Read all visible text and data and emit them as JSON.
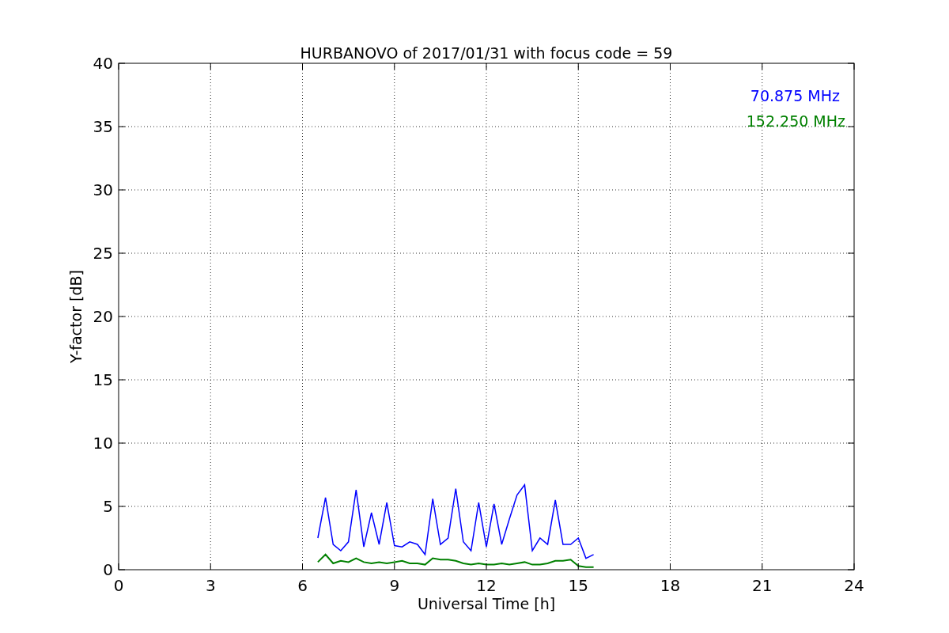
{
  "figure": {
    "chart_data": {
      "type": "line",
      "title": "HURBANOVO of 2017/01/31 with focus code = 59",
      "xlabel": "Universal Time [h]",
      "ylabel": "Y-factor [dB]",
      "x": [
        6.5,
        6.75,
        7,
        7.25,
        7.5,
        7.75,
        8,
        8.25,
        8.5,
        8.75,
        9,
        9.25,
        9.5,
        9.75,
        10,
        10.25,
        10.5,
        10.75,
        11,
        11.25,
        11.5,
        11.75,
        12,
        12.25,
        12.5,
        12.75,
        13,
        13.25,
        13.5,
        13.75,
        14,
        14.25,
        14.5,
        14.75,
        15,
        15.25,
        15.5
      ],
      "series": [
        {
          "name": "70.875 MHz",
          "color": "#0000ff",
          "values": [
            2.5,
            5.7,
            2.0,
            1.5,
            2.2,
            6.3,
            1.8,
            4.5,
            2.0,
            5.3,
            1.9,
            1.8,
            2.2,
            2.0,
            1.2,
            5.6,
            2.0,
            2.5,
            6.4,
            2.2,
            1.5,
            5.3,
            1.8,
            5.2,
            2.0,
            4.0,
            5.9,
            6.7,
            1.5,
            2.5,
            2.0,
            5.5,
            2.0,
            2.0,
            2.5,
            0.9,
            1.2
          ]
        },
        {
          "name": "152.250 MHz",
          "color": "#008000",
          "values": [
            0.6,
            1.2,
            0.5,
            0.7,
            0.6,
            0.9,
            0.6,
            0.5,
            0.6,
            0.5,
            0.6,
            0.7,
            0.5,
            0.5,
            0.4,
            0.9,
            0.8,
            0.8,
            0.7,
            0.5,
            0.4,
            0.5,
            0.4,
            0.4,
            0.5,
            0.4,
            0.5,
            0.6,
            0.4,
            0.4,
            0.5,
            0.7,
            0.7,
            0.8,
            0.3,
            0.2,
            0.2
          ]
        }
      ],
      "grid": true,
      "xlim": [
        0,
        24
      ],
      "ylim": [
        0,
        40
      ],
      "xticks": [
        0,
        3,
        6,
        9,
        12,
        15,
        18,
        21,
        24
      ],
      "yticks": [
        0,
        5,
        10,
        15,
        20,
        25,
        30,
        35,
        40
      ]
    }
  }
}
